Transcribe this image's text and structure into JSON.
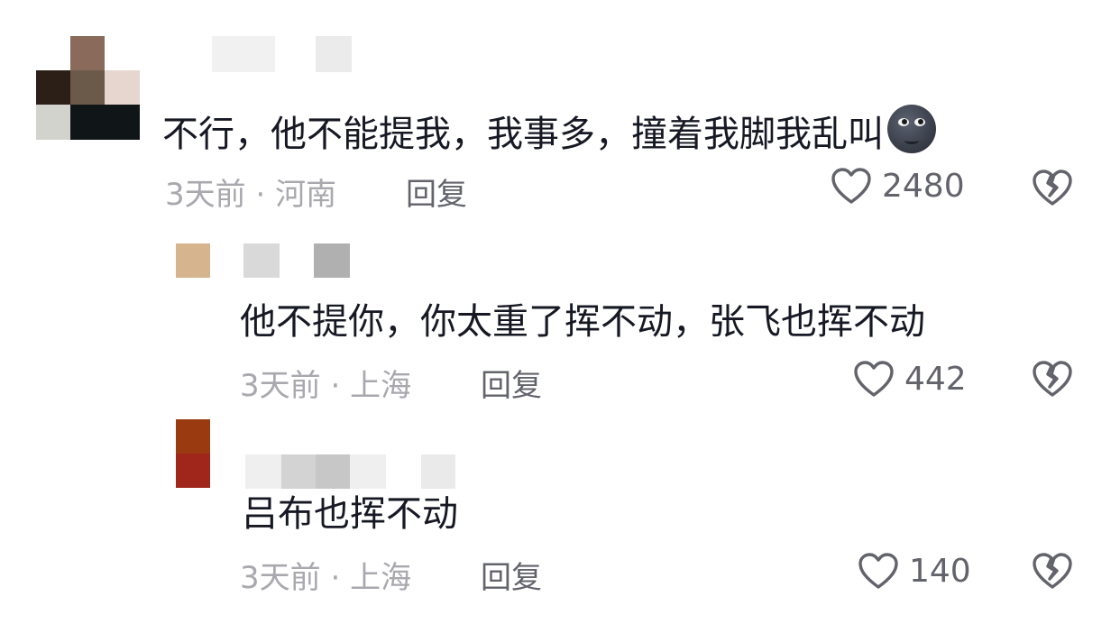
{
  "comments": [
    {
      "text": "不行，他不能提我，我事多，撞着我脚我乱叫",
      "emoji_icon": "new-moon-face-emoji",
      "time": "3天前",
      "location": "河南",
      "reply_label": "回复",
      "likes": "2480"
    },
    {
      "text": "他不提你，你太重了挥不动，张飞也挥不动",
      "time": "3天前",
      "location": "上海",
      "reply_label": "回复",
      "likes": "442"
    },
    {
      "text": "吕布也挥不动",
      "time": "3天前",
      "location": "上海",
      "reply_label": "回复",
      "likes": "140"
    }
  ],
  "meta_separator": "·",
  "icons": {
    "like": "heart-outline-icon",
    "dislike": "broken-heart-icon"
  },
  "colors": {
    "text": "#161823",
    "meta": "#a8a8ae",
    "action": "#62636b"
  }
}
